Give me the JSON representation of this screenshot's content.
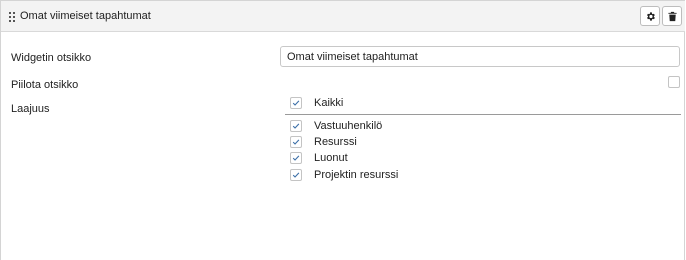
{
  "header": {
    "title": "Omat viimeiset tapahtumat",
    "drag_icon": "drag-handle-icon",
    "settings_icon": "gear-icon",
    "delete_icon": "trash-icon"
  },
  "form": {
    "widget_title_label": "Widgetin otsikko",
    "widget_title_value": "Omat viimeiset tapahtumat",
    "hide_title_label": "Piilota otsikko",
    "hide_title_checked": false,
    "scope_label": "Laajuus",
    "scope_all": {
      "label": "Kaikki",
      "checked": true
    },
    "scope_options": [
      {
        "label": "Vastuuhenkilö",
        "checked": true
      },
      {
        "label": "Resurssi",
        "checked": true
      },
      {
        "label": "Luonut",
        "checked": true
      },
      {
        "label": "Projektin resurssi",
        "checked": true
      }
    ]
  },
  "colors": {
    "check_mark": "#3c6fa8",
    "header_bg": "#f3f3f3"
  }
}
